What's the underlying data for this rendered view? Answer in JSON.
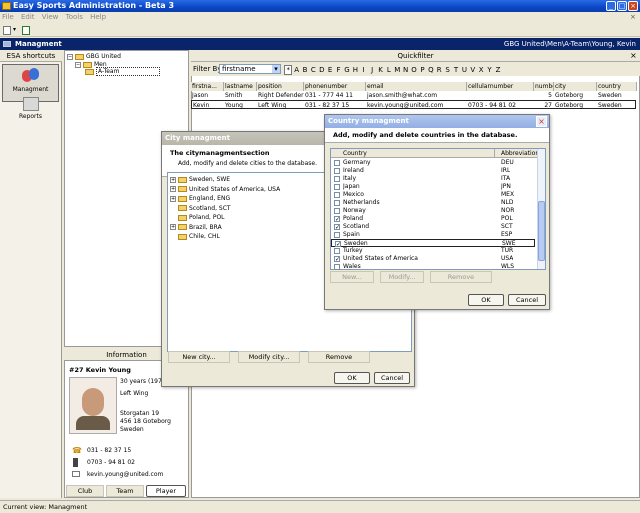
{
  "app": {
    "title": "Easy Sports Administration - Beta 3",
    "menu": [
      "File",
      "Edit",
      "View",
      "Tools",
      "Help"
    ]
  },
  "section": {
    "title": "Managment",
    "context": "GBG United\\Men\\A-Team\\Young, Kevin"
  },
  "shortcuts": {
    "title": "ESA shortcuts",
    "items": [
      {
        "label": "Managment"
      },
      {
        "label": "Reports"
      }
    ]
  },
  "tree": {
    "root": "GBG United",
    "group": "Men",
    "team": "A-Team"
  },
  "quickfilter": {
    "title": "Quickfilter",
    "filter_label": "Filter By:",
    "filter_value": "firstname",
    "letters": [
      "*",
      "A",
      "B",
      "C",
      "D",
      "E",
      "F",
      "G",
      "H",
      "I",
      "J",
      "K",
      "L",
      "M",
      "N",
      "O",
      "P",
      "Q",
      "R",
      "S",
      "T",
      "U",
      "V",
      "X",
      "Y",
      "Z"
    ]
  },
  "players": {
    "columns": [
      "firstna...",
      "lastname",
      "position",
      "phonenumber",
      "email",
      "cellularnumber",
      "number",
      "city",
      "country"
    ],
    "rows": [
      [
        "Jason",
        "Smith",
        "Right Defender",
        "031 - 777 44 11",
        "jason.smith@what.com",
        "",
        "5",
        "Goteborg",
        "Sweden"
      ],
      [
        "Kevin",
        "Young",
        "Left Wing",
        "031 - 82 37 15",
        "kevin.young@united.com",
        "0703 - 94 81 02",
        "27",
        "Goteborg",
        "Sweden"
      ]
    ]
  },
  "info": {
    "title": "Information",
    "number_name": "#27  Kevin Young",
    "age": "30 years",
    "birth": "(197",
    "position": "Left Wing",
    "street": "Storgatan 19",
    "zip_city": "456 18 Goteborg",
    "country": "Sweden",
    "phone": "031 - 82 37 15",
    "cell": "0703 - 94 81 02",
    "email": "kevin.young@united.com",
    "tabs": [
      "Club",
      "Team",
      "Player"
    ]
  },
  "city_dialog": {
    "title": "City managment",
    "header": "The citymanagmentsection",
    "subheader": "Add, modify and delete cities to the database.",
    "items": [
      {
        "name": "Sweden, SWE",
        "exp": true
      },
      {
        "name": "United States of America, USA",
        "exp": true
      },
      {
        "name": "England, ENG",
        "exp": true
      },
      {
        "name": "Scotland, SCT",
        "exp": false
      },
      {
        "name": "Poland, POL",
        "exp": false
      },
      {
        "name": "Brazil, BRA",
        "exp": true
      },
      {
        "name": "Chile, CHL",
        "exp": false
      }
    ],
    "new": "New city...",
    "modify": "Modify city...",
    "remove": "Remove",
    "ok": "OK",
    "cancel": "Cancel"
  },
  "country_dialog": {
    "title": "Country managment",
    "header": "Add, modify and delete countries in the database.",
    "col_country": "Country",
    "col_abbr": "Abbreviation",
    "rows": [
      [
        "Germany",
        "DEU",
        false
      ],
      [
        "Ireland",
        "IRL",
        false
      ],
      [
        "Italy",
        "ITA",
        false
      ],
      [
        "Japan",
        "JPN",
        false
      ],
      [
        "Mexico",
        "MEX",
        false
      ],
      [
        "Netherlands",
        "NLD",
        false
      ],
      [
        "Norway",
        "NOR",
        false
      ],
      [
        "Poland",
        "POL",
        true
      ],
      [
        "Scotland",
        "SCT",
        true
      ],
      [
        "Spain",
        "ESP",
        false
      ],
      [
        "Sweden",
        "SWE",
        true
      ],
      [
        "Turkey",
        "TUR",
        false
      ],
      [
        "United States of America",
        "USA",
        true
      ],
      [
        "Wales",
        "WLS",
        false
      ]
    ],
    "selected": "Sweden",
    "new": "New...",
    "modify": "Modify...",
    "remove": "Remove",
    "ok": "OK",
    "cancel": "Cancel"
  },
  "status": "Current view: Managment"
}
